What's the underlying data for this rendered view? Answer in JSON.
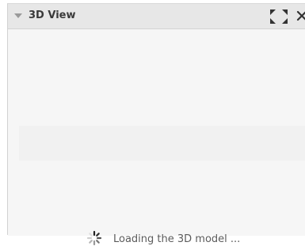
{
  "panel": {
    "title": "3D View",
    "loading_text": "Loading the 3D model ..."
  },
  "icons": {
    "collapse": "collapse-triangle-icon",
    "expand": "fullscreen-expand-icon",
    "close": "close-icon",
    "spinner": "loading-spinner-icon"
  },
  "colors": {
    "header_bg": "#e7e7e7",
    "content_bg": "#f6f6f6",
    "title_text": "#3a3a3a",
    "loading_text": "#5b5b5b"
  }
}
